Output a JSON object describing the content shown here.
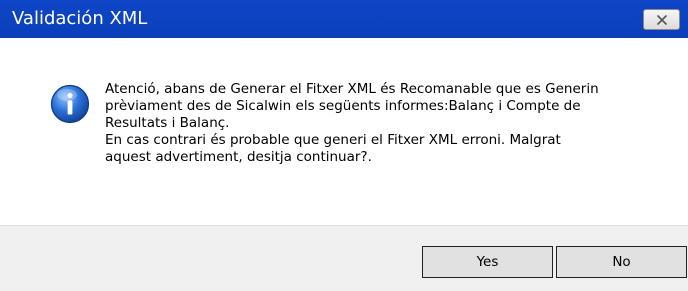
{
  "dialog": {
    "title": "Validación XML",
    "close_icon": "close-x-icon",
    "info_icon": "information-icon",
    "message_lines": [
      "Atenció, abans de Generar el Fitxer XML és Recomanable que es Generin",
      "prèviament des de Sicalwin els següents informes:Balanç i Compte de",
      "Resultats i Balanç.",
      "En cas contrari és probable que generi el Fitxer XML erroni. Malgrat",
      "aquest advertiment, desitja continuar?."
    ],
    "buttons": {
      "yes_label": "Yes",
      "no_label": "No"
    }
  },
  "colors": {
    "title_bar": "#0f46c8",
    "title_text": "#ffffff",
    "content_bg": "#ffffff",
    "button_bar_bg": "#f0f0f0",
    "icon_blue": "#2a6fd6"
  }
}
